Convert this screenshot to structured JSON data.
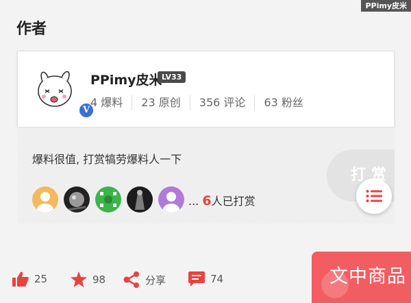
{
  "watermark": "PPimy皮米",
  "section": {
    "title": "作者"
  },
  "author": {
    "name": "PPimy皮米",
    "level": "LV33",
    "verified_badge": "V",
    "stats": [
      {
        "count": "4",
        "label": "爆料"
      },
      {
        "count": "23",
        "label": "原创"
      },
      {
        "count": "356",
        "label": "评论"
      },
      {
        "count": "63",
        "label": "粉丝"
      }
    ]
  },
  "tip": {
    "message": "爆料很值, 打赏犒劳爆料人一下",
    "ellipsis": "...",
    "count": "6",
    "count_suffix": "人已打赏",
    "button_label": "打赏",
    "avatars": [
      "tipper-avatar-1",
      "tipper-avatar-2",
      "tipper-avatar-3",
      "tipper-avatar-4",
      "tipper-avatar-5"
    ]
  },
  "actions": {
    "like": {
      "icon": "thumbs-up-icon",
      "count": "25"
    },
    "favorite": {
      "icon": "star-icon",
      "count": "98"
    },
    "share": {
      "icon": "share-icon",
      "label": "分享"
    },
    "comment": {
      "icon": "comment-icon",
      "count": "74"
    }
  },
  "promo": {
    "label": "文中商品"
  },
  "colors": {
    "accent": "#e8423f",
    "promo": "#f25d62",
    "verified": "#3a6fd6"
  }
}
